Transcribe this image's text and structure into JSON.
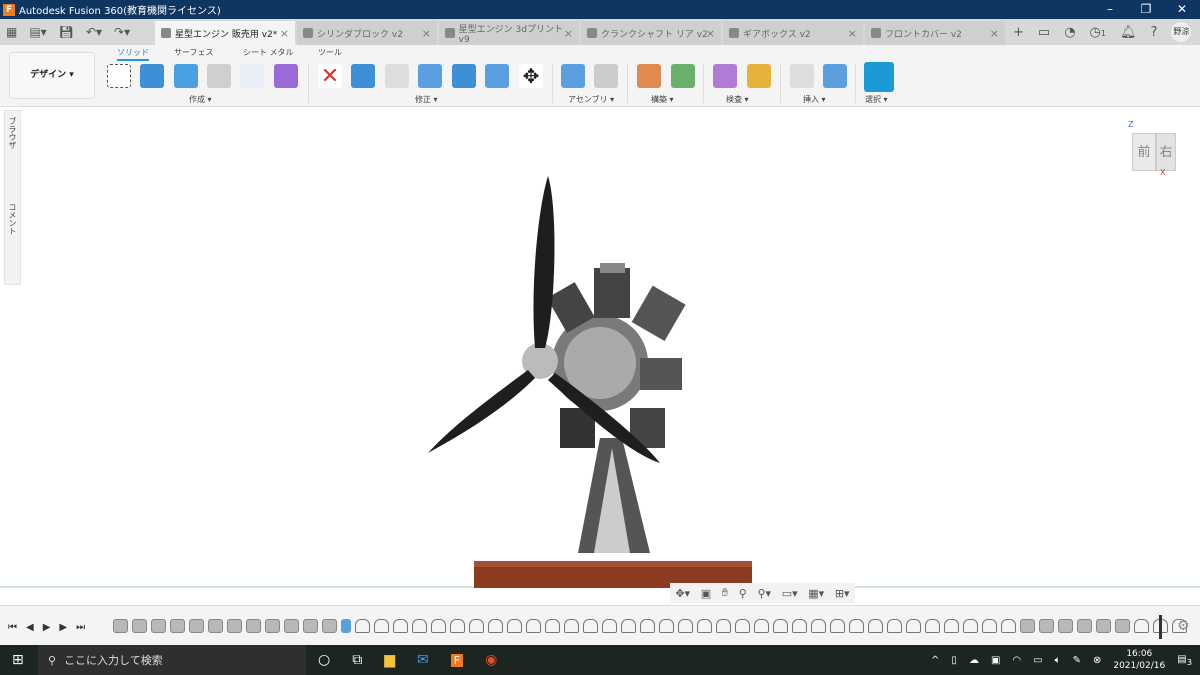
{
  "window": {
    "title": "Autodesk Fusion 360(教育機関ライセンス)",
    "minimize": "–",
    "maximize": "❐",
    "close": "✕"
  },
  "tabs": [
    {
      "label": "星型エンジン 販売用 v2*",
      "active": true
    },
    {
      "label": "シリンダブロック v2",
      "active": false
    },
    {
      "label": "星型エンジン 3dプリント v9",
      "active": false
    },
    {
      "label": "クランクシャフト リア v2",
      "active": false
    },
    {
      "label": "ギアボックス v2",
      "active": false
    },
    {
      "label": "フロントカバー v2",
      "active": false
    }
  ],
  "tab_right": {
    "add": "+",
    "jobs_count": "1",
    "user": "野涼"
  },
  "toolbar": {
    "workspace": "デザイン ▾",
    "subtabs": [
      "ソリッド",
      "サーフェス",
      "シート メタル",
      "ツール"
    ],
    "groups": [
      "作成 ▾",
      "修正 ▾",
      "アセンブリ ▾",
      "構築 ▾",
      "検査 ▾",
      "挿入 ▾",
      "選択 ▾"
    ]
  },
  "left_panel": {
    "browser": "ブラウザ",
    "comments": "コメント"
  },
  "viewcube": {
    "front": "前",
    "right": "右",
    "z": "Z",
    "x": "X"
  },
  "timeline": {
    "items": [
      "feature",
      "feature",
      "feature",
      "feature",
      "feature",
      "feature",
      "feature",
      "feature",
      "feature",
      "feature",
      "feature",
      "feature",
      "sketch",
      "joint",
      "joint",
      "joint",
      "joint",
      "joint",
      "joint",
      "joint",
      "joint",
      "joint",
      "joint",
      "joint",
      "joint",
      "joint",
      "joint",
      "joint",
      "joint",
      "joint",
      "joint",
      "joint",
      "joint",
      "joint",
      "joint",
      "joint",
      "joint",
      "joint",
      "joint",
      "joint",
      "joint",
      "joint",
      "joint",
      "joint",
      "joint",
      "joint",
      "joint",
      "joint",
      "feature",
      "feature",
      "feature",
      "feature",
      "feature",
      "feature",
      "joint",
      "joint",
      "joint"
    ]
  },
  "taskbar": {
    "search_placeholder": "ここに入力して検索",
    "time": "16:06",
    "date": "2021/02/16",
    "notifications": "3"
  },
  "colors": {
    "titlebar": "#0f3660",
    "accent": "#1a9ad6"
  }
}
